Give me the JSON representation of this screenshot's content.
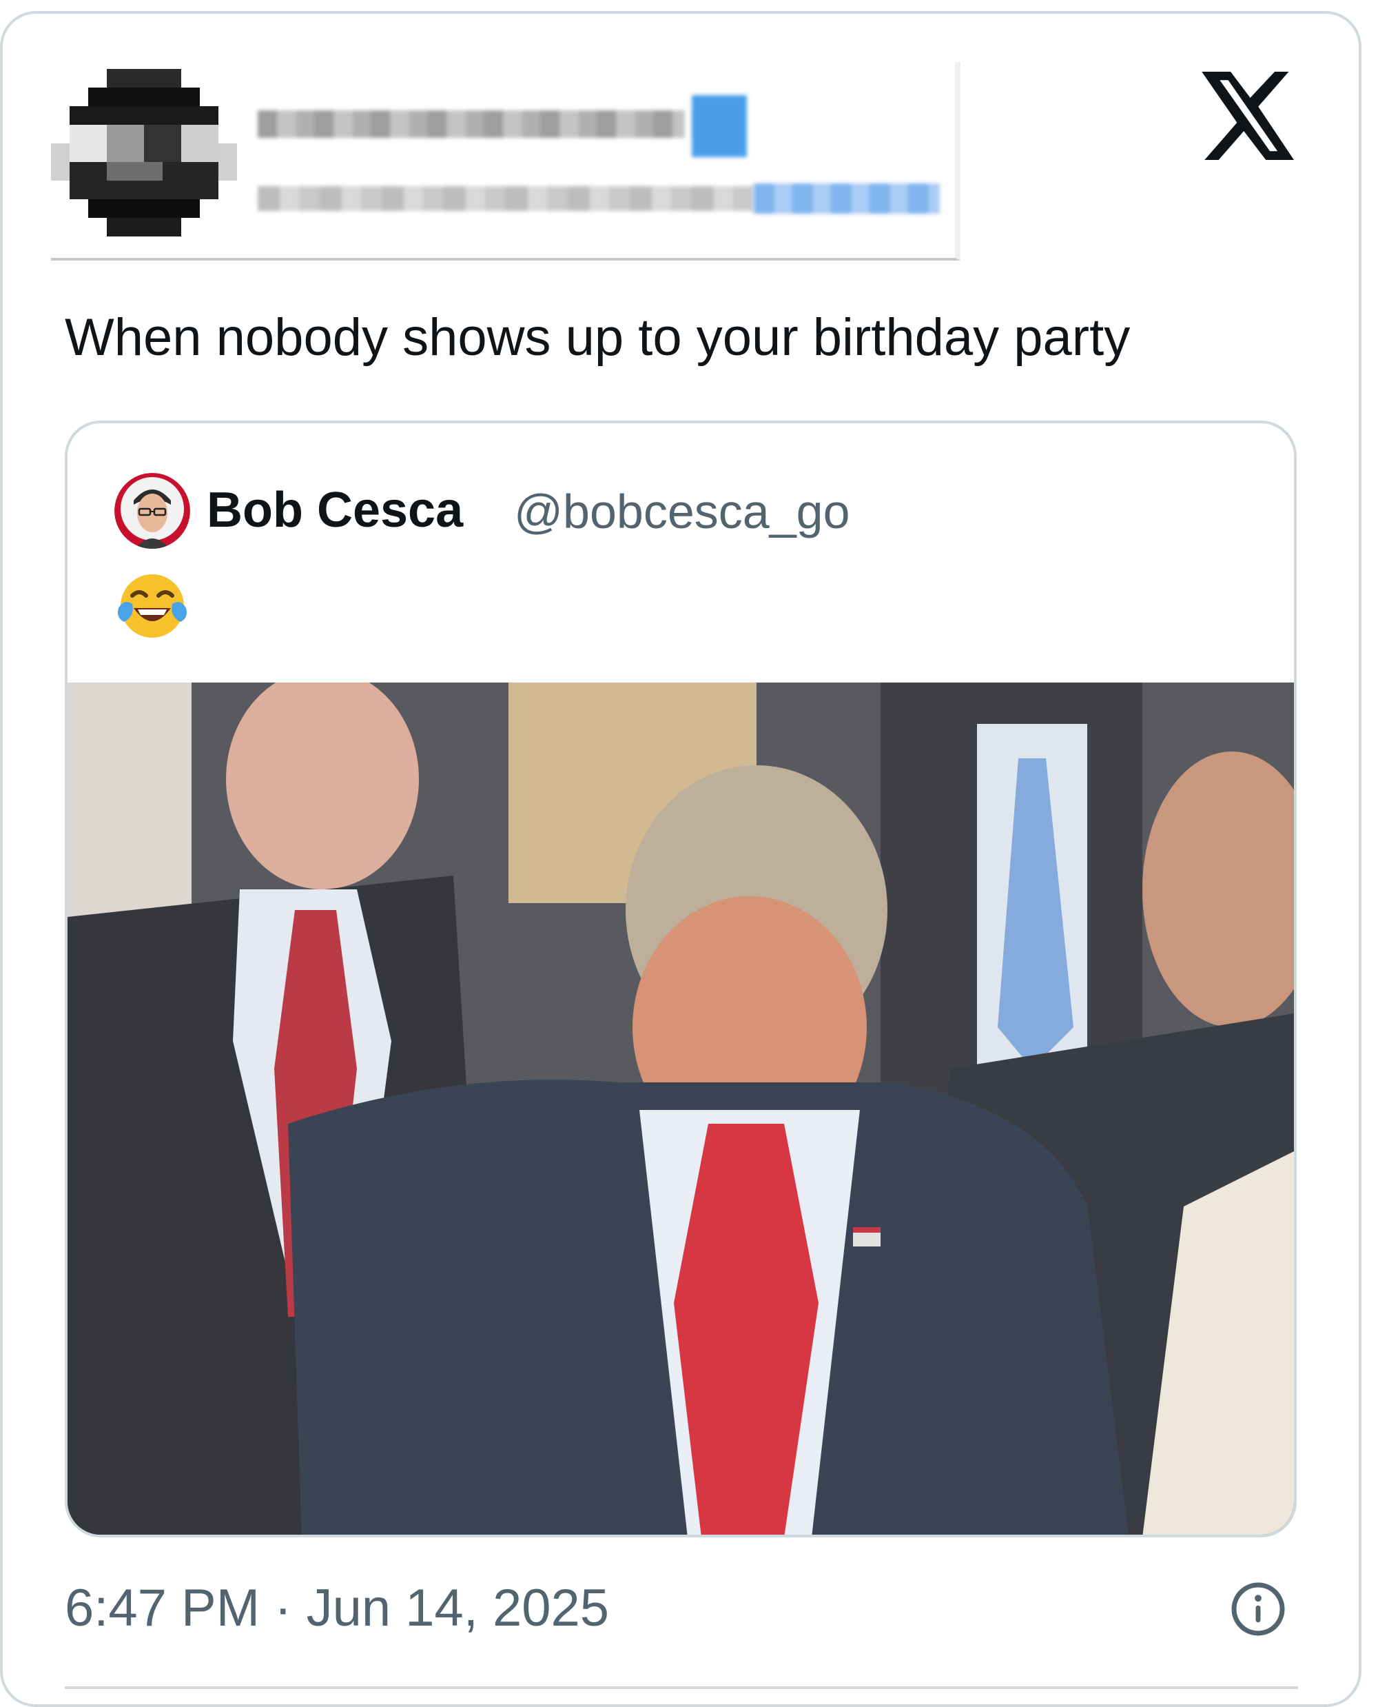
{
  "tweet": {
    "text": "When nobody shows up to your birthday party",
    "timestamp": "6:47 PM · Jun 14, 2025"
  },
  "quoted_tweet": {
    "author_name": "Bob Cesca",
    "author_handle": "@bobcesca_go",
    "text_emoji": "face-with-tears-of-joy"
  },
  "icons": {
    "brand": "x-logo",
    "info": "info-icon"
  },
  "colors": {
    "text_primary": "#0f1419",
    "text_secondary": "#536471",
    "border": "#cfd9de",
    "redacted_blue": "#4a9ee8"
  }
}
